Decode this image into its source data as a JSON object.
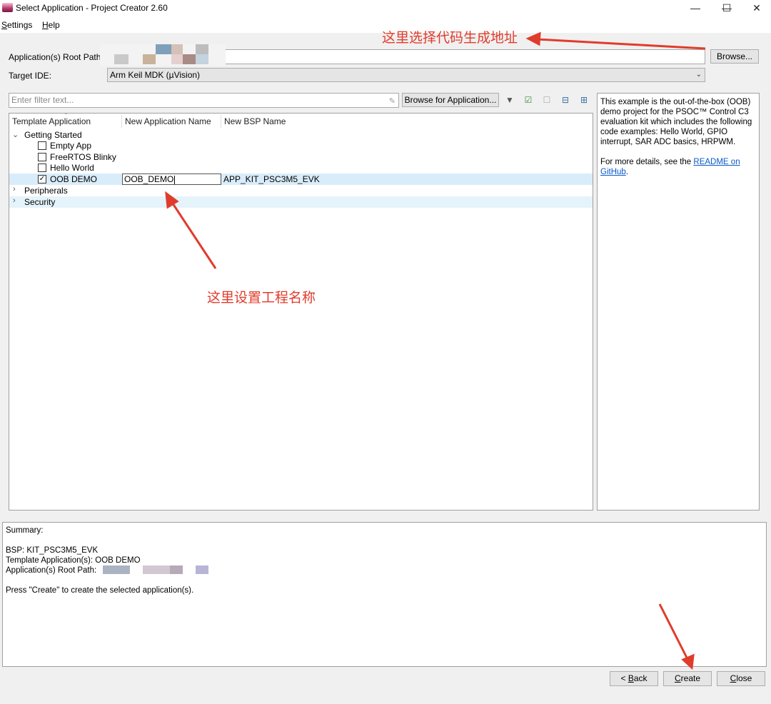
{
  "window": {
    "title": "Select Application - Project Creator 2.60",
    "minimize_glyph": "—",
    "maximize_glyph": "☐",
    "close_glyph": "✕"
  },
  "menu": {
    "settings_first": "S",
    "settings_rest": "ettings",
    "help_first": "H",
    "help_rest": "elp"
  },
  "root_path": {
    "label": "Application(s) Root Path",
    "value": "",
    "browse_label": "Browse..."
  },
  "target_ide": {
    "label": "Target IDE:",
    "selected": "Arm Keil MDK (µVision)"
  },
  "filter": {
    "placeholder": "Enter filter text...",
    "browse_apps_label": "Browse for Application...",
    "icons": [
      "filter-icon",
      "select-all-icon",
      "deselect-all-icon",
      "collapse-all-icon",
      "expand-all-icon"
    ]
  },
  "tree": {
    "columns": [
      "Template Application",
      "New Application Name",
      "New BSP Name"
    ],
    "groups": [
      {
        "label": "Getting Started",
        "expanded": true,
        "items": [
          {
            "label": "Empty App",
            "checked": false,
            "app_name": "",
            "bsp_name": ""
          },
          {
            "label": "FreeRTOS Blinky",
            "checked": false,
            "app_name": "",
            "bsp_name": ""
          },
          {
            "label": "Hello World",
            "checked": false,
            "app_name": "",
            "bsp_name": ""
          },
          {
            "label": "OOB DEMO",
            "checked": true,
            "app_name": "OOB_DEMO",
            "bsp_name": "APP_KIT_PSC3M5_EVK"
          }
        ]
      },
      {
        "label": "Peripherals",
        "expanded": false
      },
      {
        "label": "Security",
        "expanded": false
      }
    ]
  },
  "description": {
    "text": "This example is the out-of-the-box (OOB) demo project for the PSOC™ Control C3 evaluation kit which includes the following code examples: Hello World, GPIO interrupt, SAR ADC basics, HRPWM.",
    "more_prefix": "For more details, see the ",
    "link_text": "README on GitHub",
    "more_suffix": "."
  },
  "summary": {
    "heading": "Summary:",
    "bsp": "BSP: KIT_PSC3M5_EVK",
    "template_apps": "Template Application(s): OOB DEMO",
    "root_path": "Application(s) Root Path:",
    "instruction": "Press \"Create\" to create the selected application(s)."
  },
  "buttons": {
    "back_prefix": "< ",
    "back_first": "B",
    "back_rest": "ack",
    "create_first": "C",
    "create_rest": "reate",
    "close_first": "C",
    "close_rest": "lose"
  },
  "annotations": {
    "top": "这里选择代码生成地址",
    "middle": "这里设置工程名称"
  },
  "colors": {
    "annotation": "#e03c2c",
    "selection_row": "#d9ecfa",
    "link": "#0a58ca"
  }
}
